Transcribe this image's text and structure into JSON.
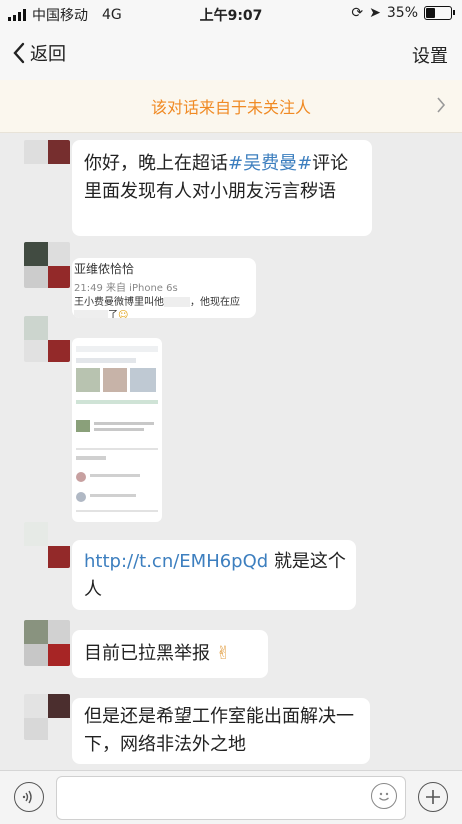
{
  "status_bar": {
    "carrier": "中国移动",
    "network": "4G",
    "time": "上午9:07",
    "battery": "35%"
  },
  "nav": {
    "back_label": "返回",
    "settings_label": "设置"
  },
  "notice": {
    "text": "该对话来自于未关注人"
  },
  "messages": [
    {
      "pre": "你好，晚上在超话",
      "tag": "#吴费曼#",
      "post": "评论里面发现有人对小朋友污言秽语"
    },
    {
      "name": "亚维侬恰恰",
      "time_source": "21:49  来自 iPhone 6s",
      "body": "王小费曼微博里叫他",
      "body2": "，他现在应",
      "body3": "了"
    },
    {
      "link": "http://t.cn/EMH6pQd",
      "text": "就是这个人"
    },
    {
      "text": "目前已拉黑举报",
      "emoji": "✌"
    },
    {
      "text": "但是还是希望工作室能出面解决一下，网络非法外之地"
    }
  ]
}
